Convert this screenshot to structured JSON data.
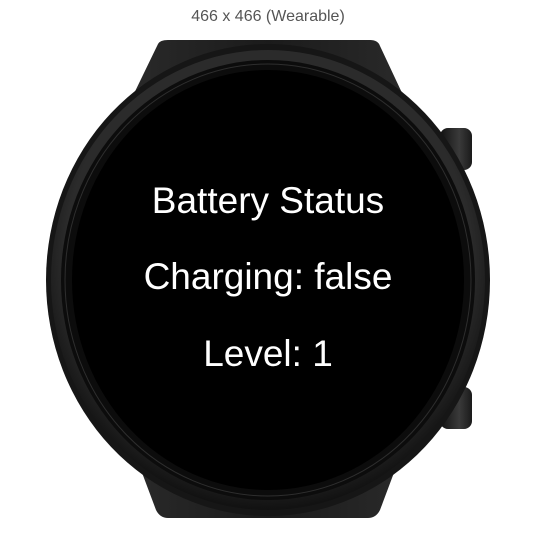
{
  "device": {
    "label": "466 x 466 (Wearable)"
  },
  "screen": {
    "title": "Battery Status",
    "charging": "Charging: false",
    "level": "Level: 1"
  },
  "colors": {
    "bezel": "#1c1c1c",
    "strap": "#1a1a1a",
    "screen": "#000000",
    "text": "#ffffff",
    "label": "#555555"
  }
}
